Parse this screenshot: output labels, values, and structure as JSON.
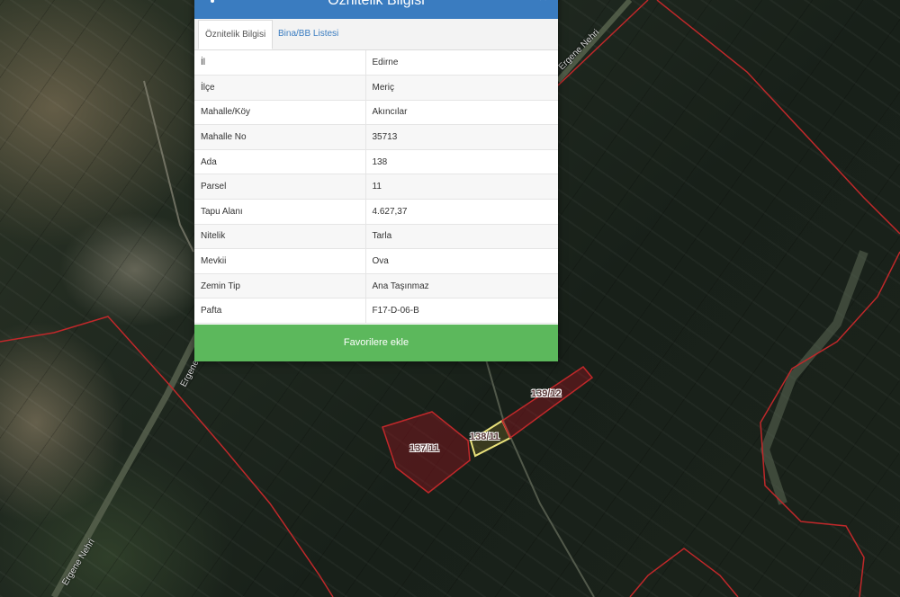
{
  "map": {
    "river_labels": [
      "Ergene Nehri",
      "Ergene",
      "Ergene Nehri"
    ],
    "parcel_labels": [
      "137/11",
      "138/11",
      "139/12"
    ],
    "colors": {
      "boundary": "#c0282a",
      "selected_parcel": "#e8e07a"
    }
  },
  "panel": {
    "title": "Öznitelik Bilgisi",
    "menu_icon": "vertical-dots-icon",
    "close_icon": "close-icon",
    "tabs": [
      {
        "label": "Öznitelik Bilgisi",
        "active": true
      },
      {
        "label": "Bina/BB Listesi",
        "active": false
      }
    ],
    "rows": [
      {
        "key": "İl",
        "value": "Edirne"
      },
      {
        "key": "İlçe",
        "value": "Meriç"
      },
      {
        "key": "Mahalle/Köy",
        "value": "Akıncılar"
      },
      {
        "key": "Mahalle No",
        "value": "35713"
      },
      {
        "key": "Ada",
        "value": "138"
      },
      {
        "key": "Parsel",
        "value": "11"
      },
      {
        "key": "Tapu Alanı",
        "value": "4.627,37"
      },
      {
        "key": "Nitelik",
        "value": "Tarla"
      },
      {
        "key": "Mevkii",
        "value": "Ova"
      },
      {
        "key": "Zemin Tip",
        "value": "Ana Taşınmaz"
      },
      {
        "key": "Pafta",
        "value": "F17-D-06-B"
      }
    ],
    "favorite_button": "Favorilere ekle",
    "colors": {
      "header": "#3a7cc0",
      "button": "#5cb85c"
    }
  }
}
